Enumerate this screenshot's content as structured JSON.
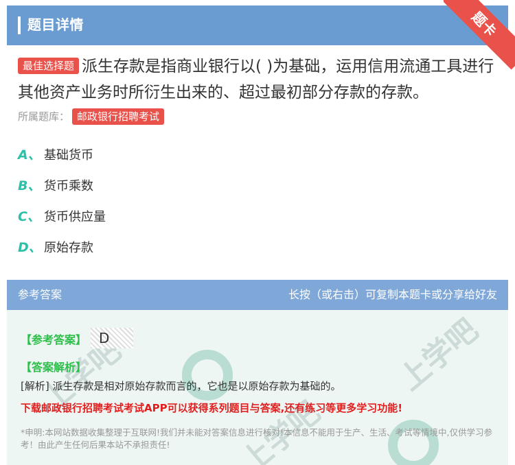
{
  "header": {
    "title": "题目详情",
    "ribbon": "题卡"
  },
  "question": {
    "type_tag": "最佳选择题",
    "text": "派生存款是指商业银行以( )为基础，运用信用流通工具进行其他资产业务时所衍生出来的、超过最初部分存款的存款。",
    "bank_label": "所属题库：",
    "bank_name": "邮政银行招聘考试"
  },
  "options": [
    {
      "letter": "A、",
      "text": "基础货币"
    },
    {
      "letter": "B、",
      "text": "货币乘数"
    },
    {
      "letter": "C、",
      "text": "货币供应量"
    },
    {
      "letter": "D、",
      "text": "原始存款"
    }
  ],
  "answer": {
    "section_title": "参考答案",
    "hint": "长按（或右击）可复制本题卡或分享给好友",
    "answer_label": "【参考答案】",
    "answer_value": "D",
    "analysis_label": "【答案解析】",
    "analysis_text": "[解析] 派生存款是相对原始存款而言的，它也是以原始存款为基础的。",
    "promo": "下载邮政银行招聘考试考试APP可以获得系列题目与答案,还有练习等更多学习功能!",
    "disclaimer": "*申明:本网站数据收集整理于互联网!我们并未能对答案信息进行核对!本信息不能用于生产、生活、考试等情境中,仅供学习参考！由此产生任何后果本站不承担责任!"
  },
  "colors": {
    "header_bg": "#6a9bd1",
    "accent_red": "#e8524b",
    "option_letter": "#2dbfa8",
    "answer_green": "#2dbf4a",
    "promo_red": "#e02020"
  }
}
